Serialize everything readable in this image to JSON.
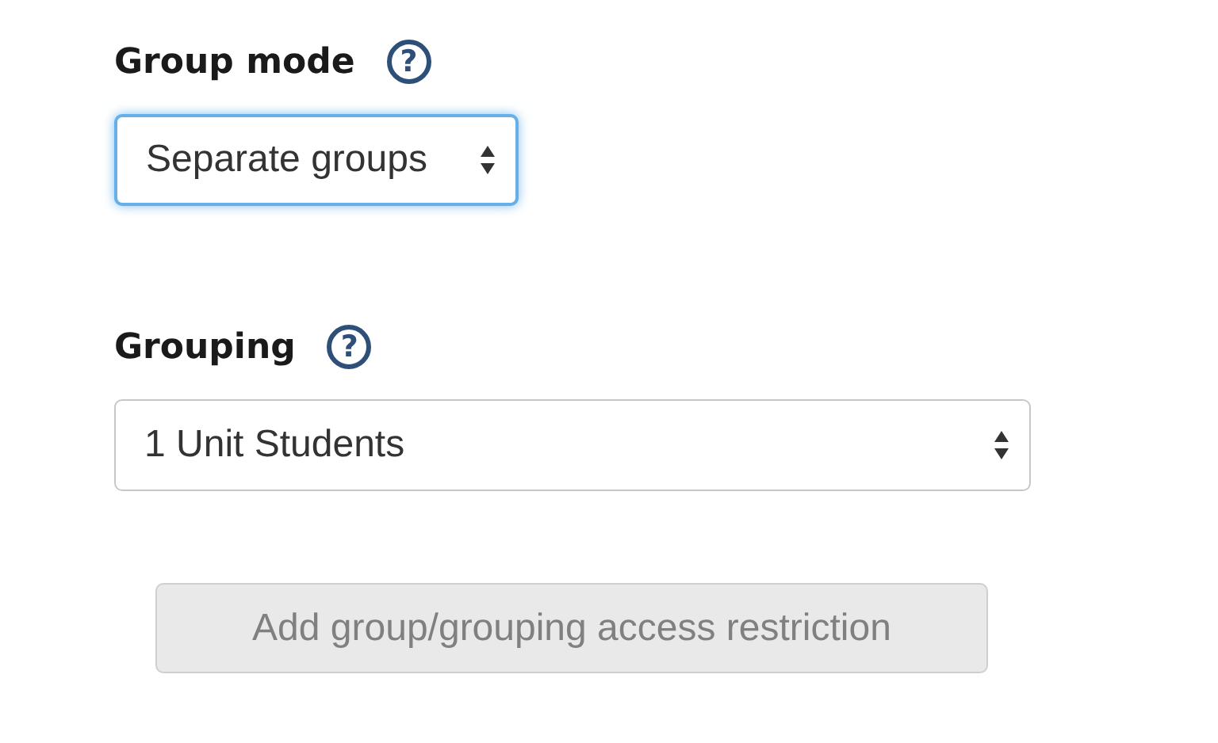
{
  "fields": [
    {
      "label": "Group mode",
      "help": "?",
      "value": "Separate groups",
      "focused": true,
      "kind": "compact"
    },
    {
      "label": "Grouping",
      "help": "?",
      "value": "1 Unit Students",
      "focused": false,
      "kind": "wide"
    }
  ],
  "button": {
    "label": "Add group/grouping access restriction",
    "disabled": true
  }
}
